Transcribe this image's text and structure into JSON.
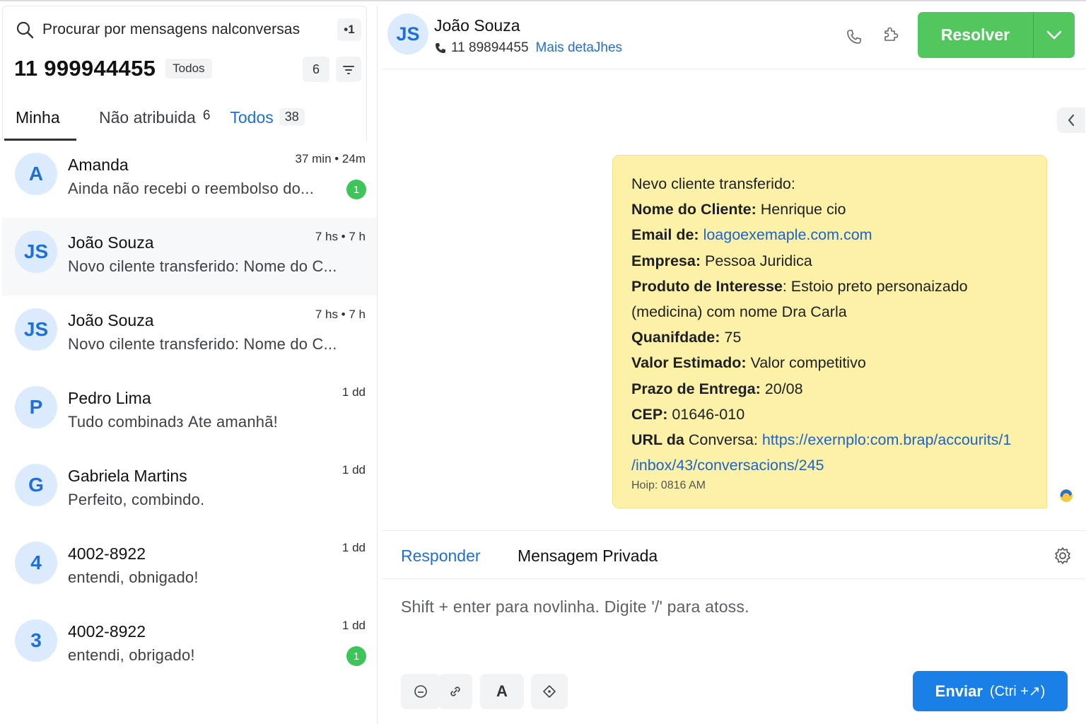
{
  "sidebar": {
    "search_placeholder": "Procurar por mensagens nalconversas",
    "search_badge": "•1",
    "inbox_title": "11 999944455",
    "inbox_status": "Todos",
    "open_count": "6",
    "tabs": [
      {
        "label": "Minha",
        "count": ""
      },
      {
        "label": "Não atribuida",
        "count": "6"
      },
      {
        "label": "Todos",
        "count": "38"
      }
    ],
    "conversations": [
      {
        "initials": "A",
        "name": "Amanda",
        "preview": "Ainda não recebi o reembolso do...",
        "time": "37 min • 24m",
        "unread": "1"
      },
      {
        "initials": "JS",
        "name": "João Souza",
        "preview": "Novo cilente   transferido: Nome do C...",
        "time": "7 hs • 7 h",
        "unread": ""
      },
      {
        "initials": "JS",
        "name": "João Souza",
        "preview": "Novo cilente   transferido: Nome do C...",
        "time": "7 hs • 7 h",
        "unread": ""
      },
      {
        "initials": "P",
        "name": "Pedro Lima",
        "preview": "Tudo combinadз Ate amanhã!",
        "time": "1 dd",
        "unread": ""
      },
      {
        "initials": "G",
        "name": "Gabriela Martins",
        "preview": "Perfeito, combindo.",
        "time": "1 dd",
        "unread": ""
      },
      {
        "initials": "4",
        "name": "4002-8922",
        "preview": "entendi, obnigado!",
        "time": "1 dd",
        "unread": ""
      },
      {
        "initials": "3",
        "name": "4002-8922",
        "preview": "entendi,  obrigado!",
        "time": "1 dd",
        "unread": "1"
      }
    ]
  },
  "header": {
    "initials": "JS",
    "name": "João Souza",
    "phone": "11 89894455",
    "details_link": "Mais detaJhes",
    "resolve_label": "Resolver"
  },
  "message": {
    "intro": "Nevo cliente transferido:",
    "fields": {
      "name_label": "Nome do Cliente:",
      "name_value": " Henrique cio",
      "email_label": "Email de:",
      "email_value": "loagoexemaple.com.com",
      "company_label": "Empresa:",
      "company_value": " Pessoa Juridica",
      "product_label": "Produto de Interesse",
      "product_value": ": Estoio preto personaizado",
      "product_cont": "(medicina) com nome Dra Carla",
      "qty_label": "Quanifdade:",
      "qty_value": " 75",
      "value_label": "Valor Estimado:",
      "value_value": " Valor competitivo",
      "deadline_label": "Prazo de Entrega:",
      "deadline_value": " 20/08",
      "cep_label": "CEP:",
      "cep_value": " 01646-010",
      "url_label": "URL da",
      "url_label2": " Conversa: ",
      "url_value": "https://exernplo:com.brap/accourits/1",
      "url_cont": "/inbox/43/conversacions/245"
    },
    "time": "Hoip: 0816 AM"
  },
  "reply": {
    "tab_reply": "Responder",
    "tab_private": "Mensagem Privada",
    "placeholder": "Shift + enter para novlinha. Digite '/' para atoss.",
    "tool_format": "A",
    "send_label": "Enviar",
    "send_hint": "(Ctri +↗)"
  },
  "colors": {
    "accent": "#1f6fd6",
    "resolve": "#52c75e",
    "send": "#1a7fe6",
    "bubble": "#fcf1a6",
    "unread": "#3ec55a"
  }
}
